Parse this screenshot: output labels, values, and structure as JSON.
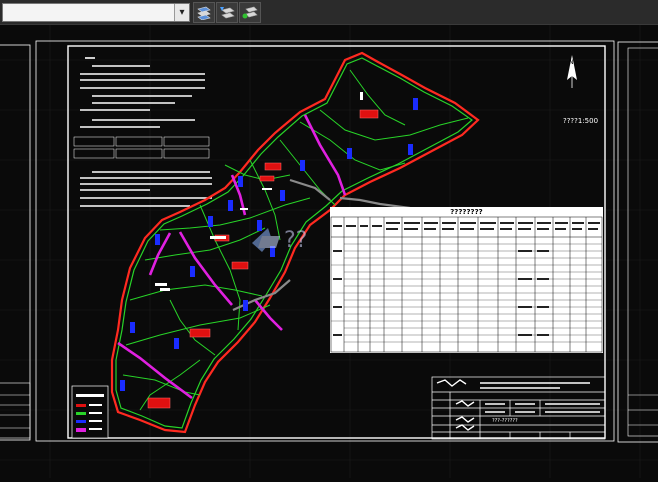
{
  "toolbar": {
    "combo_value": "",
    "buttons": [
      "layer-match-icon",
      "layer-previous-icon",
      "layer-isolate-icon"
    ]
  },
  "drawing": {
    "scale_text": "????1:500",
    "north_symbol": "N",
    "table_title": "????????",
    "title_block_drawing_name": "???-??????",
    "watermark": "??"
  },
  "colors": {
    "canvas_bg": "#0a0a0a",
    "frame": "#ffffff",
    "boundary_red": "#ff2020",
    "road_green": "#28d428",
    "magenta": "#e020e0",
    "block_blue": "#1a2cff",
    "building_red": "#e01010"
  }
}
